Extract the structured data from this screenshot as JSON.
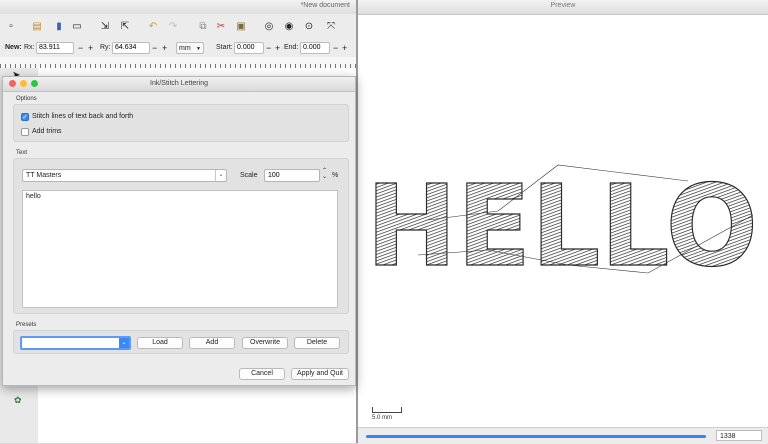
{
  "inkscape": {
    "title": "*New document",
    "toolbar_icons": [
      "new-file-icon",
      "open-file-icon",
      "save-icon",
      "print-icon",
      "import-icon",
      "export-icon",
      "undo-icon",
      "redo-icon",
      "copy-icon",
      "cut-icon",
      "paste-icon",
      "zoom-selection-icon",
      "zoom-drawing-icon",
      "zoom-page-icon",
      "zoom-fit-icon"
    ],
    "controls": {
      "new_label": "New:",
      "rx_label": "Rx:",
      "rx_value": "83.911",
      "ry_label": "Ry:",
      "ry_value": "64.634",
      "unit": "mm",
      "start_label": "Start:",
      "start_value": "0.000",
      "end_label": "End:",
      "end_value": "0.000",
      "minus": "−",
      "plus": "+"
    }
  },
  "preview": {
    "title": "Preview",
    "scale_label": "5.0 mm",
    "counter": "1338",
    "text": "HELLO",
    "accent": "#3b82f6"
  },
  "dialog": {
    "title": "Ink/Stitch Lettering",
    "options": {
      "section": "Options",
      "back_and_forth_label": "Stitch lines of text back and forth",
      "back_and_forth_checked": true,
      "add_trims_label": "Add trims",
      "add_trims_checked": false
    },
    "text_section": {
      "section": "Text",
      "font": "TT Masters",
      "scale_label": "Scale",
      "scale_value": "100",
      "percent": "%",
      "content": "hello"
    },
    "presets": {
      "section": "Presets",
      "value": "",
      "load": "Load",
      "add": "Add",
      "overwrite": "Overwrite",
      "delete": "Delete"
    },
    "cancel": "Cancel",
    "apply": "Apply and Quit",
    "traffic_colors": [
      "#fc5f57",
      "#fdbc2e",
      "#29c840"
    ]
  }
}
